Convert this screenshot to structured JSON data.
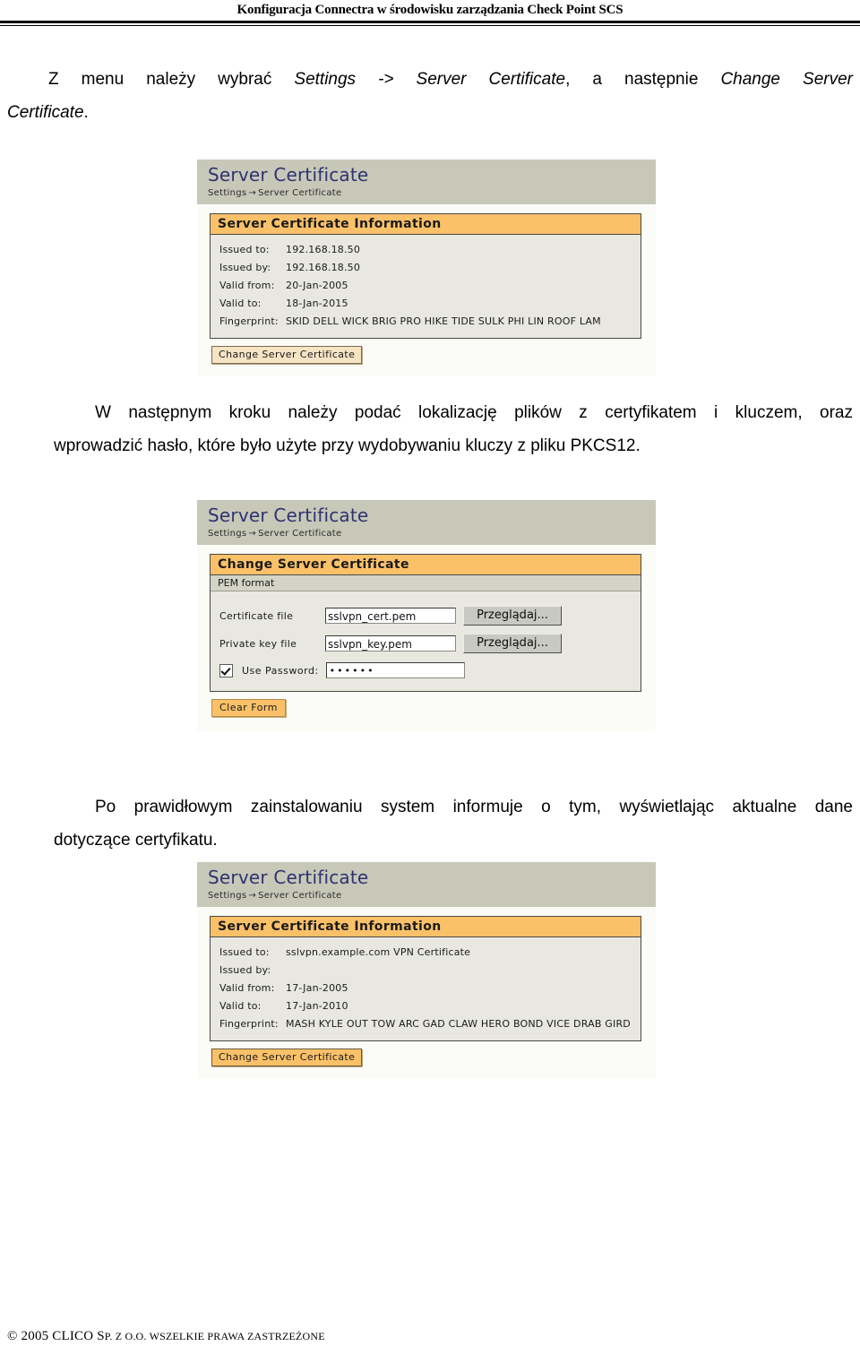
{
  "header": {
    "running_head": "Konfiguracja Connectra w środowisku zarządzania Check Point SCS"
  },
  "paragraphs": {
    "p1_a": "Z  menu  należy  wybrać  ",
    "p1_em1": "Settings -> Server Certificate",
    "p1_b": ",  a  następnie  ",
    "p1_em2": "Change Server",
    "p1_em3": "Certificate",
    "p1_c": ".",
    "p2_line1": "W  następnym  kroku  należy  podać  lokalizację  plików  z  certyfikatem  i  kluczem,  oraz",
    "p2_line2": "wprowadzić hasło, które było użyte przy wydobywaniu kluczy z pliku PKCS12.",
    "p3_line1": "Po  prawidłowym  zainstalowaniu  system  informuje  o  tym,  wyświetlając  aktualne  dane",
    "p3_line2": "dotyczące certyfikatu."
  },
  "screenshot1": {
    "app_title": "Server Certificate",
    "breadcrumb_root": "Settings",
    "breadcrumb_arrow": "→",
    "breadcrumb_leaf": "Server Certificate",
    "panel_title": "Server Certificate Information",
    "rows": [
      {
        "label": "Issued to:",
        "value": "192.168.18.50"
      },
      {
        "label": "Issued by:",
        "value": "192.168.18.50"
      },
      {
        "label": "Valid from:",
        "value": "20-Jan-2005"
      },
      {
        "label": "Valid to:",
        "value": "18-Jan-2015"
      },
      {
        "label": "Fingerprint:",
        "value": "SKID DELL WICK BRIG PRO HIKE TIDE SULK PHI LIN ROOF LAM"
      }
    ],
    "button_label": "Change Server Certificate"
  },
  "screenshot2": {
    "app_title": "Server Certificate",
    "breadcrumb_root": "Settings",
    "breadcrumb_arrow": "→",
    "breadcrumb_leaf": "Server Certificate",
    "panel_title": "Change Server Certificate",
    "panel_subtitle": "PEM format",
    "cert_label": "Certificate file",
    "cert_value": "sslvpn_cert.pem",
    "cert_browse_label": "Przeglądaj...",
    "key_label": "Private key file",
    "key_value": "sslvpn_key.pem",
    "key_browse_label": "Przeglądaj...",
    "password_label": "Use Password:",
    "password_value": "••••••",
    "clear_label": "Clear Form"
  },
  "screenshot3": {
    "app_title": "Server Certificate",
    "breadcrumb_root": "Settings",
    "breadcrumb_arrow": "→",
    "breadcrumb_leaf": "Server Certificate",
    "panel_title": "Server Certificate Information",
    "rows": [
      {
        "label": "Issued to:",
        "value": "sslvpn.example.com VPN Certificate"
      },
      {
        "label": "Issued by:",
        "value": ""
      },
      {
        "label": "Valid from:",
        "value": "17-Jan-2005"
      },
      {
        "label": "Valid to:",
        "value": "17-Jan-2010"
      },
      {
        "label": "Fingerprint:",
        "value": "MASH KYLE OUT TOW ARC GAD CLAW HERO BOND VICE DRAB GIRD"
      }
    ],
    "button_label": "Change Server Certificate"
  },
  "footer": {
    "copyright": "© 2005 CLICO S",
    "copyright_sc1": "P",
    "copyright_mid": ". Z O.O. W",
    "copyright_sc2": "SZELKIE PRAWA ZASTRZEŻONE",
    "full": "© 2005 CLICO SP. Z O.O. WSZELKIE PRAWA ZASTRZEŻONE"
  },
  "colors": {
    "banner": "#c7c8b8",
    "panel_header_orange": "#fbc169",
    "panel_body": "#e8e8e0",
    "title_navy": "#2f3270",
    "sub_band": "#d3d4c6"
  }
}
